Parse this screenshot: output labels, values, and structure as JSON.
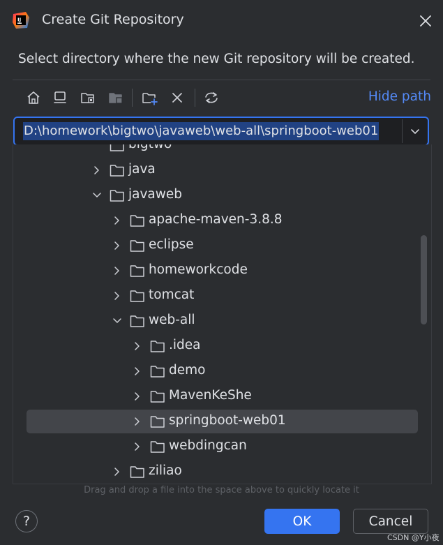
{
  "window": {
    "title": "Create Git Repository"
  },
  "dialog": {
    "description": "Select directory where the new Git repository will be created.",
    "hide_path_label": "Hide path",
    "path_value": "D:\\homework\\bigtwo\\javaweb\\web-all\\springboot-web01",
    "drag_hint": "Drag and drop a file into the space above to quickly locate it",
    "ok_label": "OK",
    "cancel_label": "Cancel",
    "help_label": "?"
  },
  "toolbar": {
    "icons": [
      "home-icon",
      "desktop-icon",
      "project-folder-icon",
      "module-folder-icon",
      "new-folder-icon",
      "delete-icon",
      "refresh-icon"
    ]
  },
  "tree": {
    "items": [
      {
        "label": "bigtwo",
        "depth": 0,
        "expanded": true,
        "partial": true
      },
      {
        "label": "java",
        "depth": 0,
        "expanded": false
      },
      {
        "label": "javaweb",
        "depth": 0,
        "expanded": true
      },
      {
        "label": "apache-maven-3.8.8",
        "depth": 1,
        "expanded": false
      },
      {
        "label": "eclipse",
        "depth": 1,
        "expanded": false
      },
      {
        "label": "homeworkcode",
        "depth": 1,
        "expanded": false
      },
      {
        "label": "tomcat",
        "depth": 1,
        "expanded": false
      },
      {
        "label": "web-all",
        "depth": 1,
        "expanded": true
      },
      {
        "label": ".idea",
        "depth": 2,
        "expanded": false
      },
      {
        "label": "demo",
        "depth": 2,
        "expanded": false
      },
      {
        "label": "MavenKeShe",
        "depth": 2,
        "expanded": false
      },
      {
        "label": "springboot-web01",
        "depth": 2,
        "expanded": false,
        "selected": true
      },
      {
        "label": "webdingcan",
        "depth": 2,
        "expanded": false
      },
      {
        "label": "ziliao",
        "depth": 1,
        "expanded": false
      }
    ]
  },
  "watermark": "CSDN @Y小夜",
  "colors": {
    "accent": "#3574f0",
    "link": "#548af7",
    "background": "#2b2d30",
    "selection": "#43454a",
    "path_highlight": "#214283"
  }
}
